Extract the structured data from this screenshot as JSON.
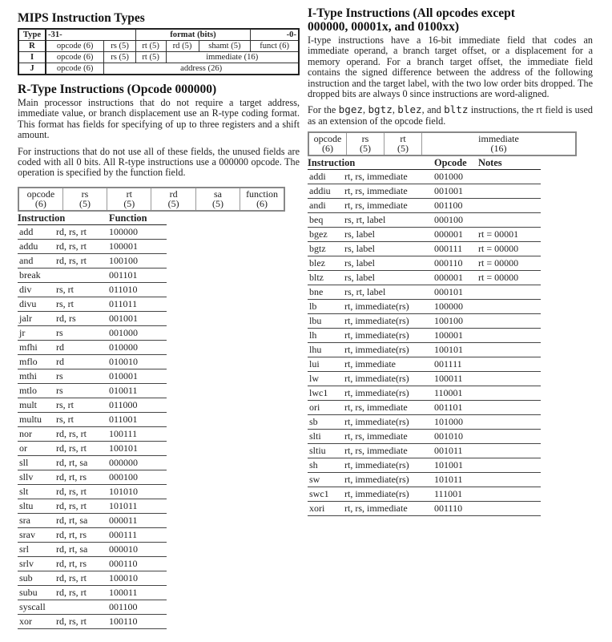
{
  "types": {
    "title": "MIPS Instruction Types",
    "header": {
      "type": "Type",
      "msb": "-31-",
      "format": "format (bits)",
      "lsb": "-0-"
    },
    "rows": [
      {
        "type": "R",
        "fields": [
          "opcode (6)",
          "rs (5)",
          "rt (5)",
          "rd (5)",
          "shamt (5)",
          "funct (6)"
        ]
      },
      {
        "type": "I",
        "fields": [
          "opcode (6)",
          "rs (5)",
          "rt (5)",
          "immediate (16)"
        ]
      },
      {
        "type": "J",
        "fields": [
          "opcode (6)",
          "address (26)"
        ]
      }
    ]
  },
  "rtype": {
    "title": "R-Type Instructions (Opcode 000000)",
    "para1": "Main processor instructions that do not require a target address, immediate value, or branch displacement use an R-type coding format. This format has fields for specifying of up to three registers and a shift amount.",
    "para2": "For instructions that do not use all of these fields, the unused fields are coded with all 0 bits. All R-type instructions use a 000000 opcode. The operation is specified by the function field.",
    "fields": [
      {
        "name": "opcode",
        "bits": "(6)"
      },
      {
        "name": "rs",
        "bits": "(5)"
      },
      {
        "name": "rt",
        "bits": "(5)"
      },
      {
        "name": "rd",
        "bits": "(5)"
      },
      {
        "name": "sa",
        "bits": "(5)"
      },
      {
        "name": "function",
        "bits": "(6)"
      }
    ],
    "columns": {
      "instruction": "Instruction",
      "function": "Function"
    },
    "instructions": [
      {
        "name": "add",
        "operands": "rd, rs, rt",
        "code": "100000"
      },
      {
        "name": "addu",
        "operands": "rd, rs, rt",
        "code": "100001"
      },
      {
        "name": "and",
        "operands": "rd, rs, rt",
        "code": "100100"
      },
      {
        "name": "break",
        "operands": "",
        "code": "001101"
      },
      {
        "name": "div",
        "operands": "rs, rt",
        "code": "011010"
      },
      {
        "name": "divu",
        "operands": "rs, rt",
        "code": "011011"
      },
      {
        "name": "jalr",
        "operands": "rd, rs",
        "code": "001001"
      },
      {
        "name": "jr",
        "operands": "rs",
        "code": "001000"
      },
      {
        "name": "mfhi",
        "operands": "rd",
        "code": "010000"
      },
      {
        "name": "mflo",
        "operands": "rd",
        "code": "010010"
      },
      {
        "name": "mthi",
        "operands": "rs",
        "code": "010001"
      },
      {
        "name": "mtlo",
        "operands": "rs",
        "code": "010011"
      },
      {
        "name": "mult",
        "operands": "rs, rt",
        "code": "011000"
      },
      {
        "name": "multu",
        "operands": "rs, rt",
        "code": "011001"
      },
      {
        "name": "nor",
        "operands": "rd, rs, rt",
        "code": "100111"
      },
      {
        "name": "or",
        "operands": "rd, rs, rt",
        "code": "100101"
      },
      {
        "name": "sll",
        "operands": "rd, rt, sa",
        "code": "000000"
      },
      {
        "name": "sllv",
        "operands": "rd, rt, rs",
        "code": "000100"
      },
      {
        "name": "slt",
        "operands": "rd, rs, rt",
        "code": "101010"
      },
      {
        "name": "sltu",
        "operands": "rd, rs, rt",
        "code": "101011"
      },
      {
        "name": "sra",
        "operands": "rd, rt, sa",
        "code": "000011"
      },
      {
        "name": "srav",
        "operands": "rd, rt, rs",
        "code": "000111"
      },
      {
        "name": "srl",
        "operands": "rd, rt, sa",
        "code": "000010"
      },
      {
        "name": "srlv",
        "operands": "rd, rt, rs",
        "code": "000110"
      },
      {
        "name": "sub",
        "operands": "rd, rs, rt",
        "code": "100010"
      },
      {
        "name": "subu",
        "operands": "rd, rs, rt",
        "code": "100011"
      },
      {
        "name": "syscall",
        "operands": "",
        "code": "001100"
      },
      {
        "name": "xor",
        "operands": "rd, rs, rt",
        "code": "100110"
      }
    ]
  },
  "itype": {
    "title": "I-Type Instructions (All opcodes except 000000, 00001x, and 0100xx)",
    "para1": "I-type instructions have a 16-bit immediate field that codes an immediate operand, a branch target offset, or a displacement for a memory operand. For a branch target offset, the immediate field contains the signed difference between the address of the following instruction and the target label, with the two low order bits dropped. The dropped bits are always 0 since instructions are word-aligned.",
    "para2": {
      "prefix": "For the ",
      "codes": [
        "bgez",
        "bgtz",
        "blez",
        "bltz"
      ],
      "sep1": ", ",
      "sep2": ", ",
      "sep3": ", and ",
      "suffix": " instructions, the rt field is used as an extension of the opcode field."
    },
    "fields": [
      {
        "name": "opcode",
        "bits": "(6)"
      },
      {
        "name": "rs",
        "bits": "(5)"
      },
      {
        "name": "rt",
        "bits": "(5)"
      },
      {
        "name": "immediate",
        "bits": "(16)"
      }
    ],
    "columns": {
      "instruction": "Instruction",
      "opcode": "Opcode",
      "notes": "Notes"
    },
    "instructions": [
      {
        "name": "addi",
        "operands": "rt, rs, immediate",
        "code": "001000",
        "notes": ""
      },
      {
        "name": "addiu",
        "operands": "rt, rs, immediate",
        "code": "001001",
        "notes": ""
      },
      {
        "name": "andi",
        "operands": "rt, rs, immediate",
        "code": "001100",
        "notes": ""
      },
      {
        "name": "beq",
        "operands": "rs, rt, label",
        "code": "000100",
        "notes": ""
      },
      {
        "name": "bgez",
        "operands": "rs, label",
        "code": "000001",
        "notes": "rt = 00001"
      },
      {
        "name": "bgtz",
        "operands": "rs, label",
        "code": "000111",
        "notes": "rt = 00000"
      },
      {
        "name": "blez",
        "operands": "rs, label",
        "code": "000110",
        "notes": "rt = 00000"
      },
      {
        "name": "bltz",
        "operands": "rs, label",
        "code": "000001",
        "notes": "rt = 00000"
      },
      {
        "name": "bne",
        "operands": "rs, rt, label",
        "code": "000101",
        "notes": ""
      },
      {
        "name": "lb",
        "operands": "rt, immediate(rs)",
        "code": "100000",
        "notes": ""
      },
      {
        "name": "lbu",
        "operands": "rt, immediate(rs)",
        "code": "100100",
        "notes": ""
      },
      {
        "name": "lh",
        "operands": "rt, immediate(rs)",
        "code": "100001",
        "notes": ""
      },
      {
        "name": "lhu",
        "operands": "rt, immediate(rs)",
        "code": "100101",
        "notes": ""
      },
      {
        "name": "lui",
        "operands": "rt, immediate",
        "code": "001111",
        "notes": ""
      },
      {
        "name": "lw",
        "operands": "rt, immediate(rs)",
        "code": "100011",
        "notes": ""
      },
      {
        "name": "lwc1",
        "operands": "rt, immediate(rs)",
        "code": "110001",
        "notes": ""
      },
      {
        "name": "ori",
        "operands": "rt, rs, immediate",
        "code": "001101",
        "notes": ""
      },
      {
        "name": "sb",
        "operands": "rt, immediate(rs)",
        "code": "101000",
        "notes": ""
      },
      {
        "name": "slti",
        "operands": "rt, rs, immediate",
        "code": "001010",
        "notes": ""
      },
      {
        "name": "sltiu",
        "operands": "rt, rs, immediate",
        "code": "001011",
        "notes": ""
      },
      {
        "name": "sh",
        "operands": "rt, immediate(rs)",
        "code": "101001",
        "notes": ""
      },
      {
        "name": "sw",
        "operands": "rt, immediate(rs)",
        "code": "101011",
        "notes": ""
      },
      {
        "name": "swc1",
        "operands": "rt, immediate(rs)",
        "code": "111001",
        "notes": ""
      },
      {
        "name": "xori",
        "operands": "rt, rs, immediate",
        "code": "001110",
        "notes": ""
      }
    ]
  }
}
